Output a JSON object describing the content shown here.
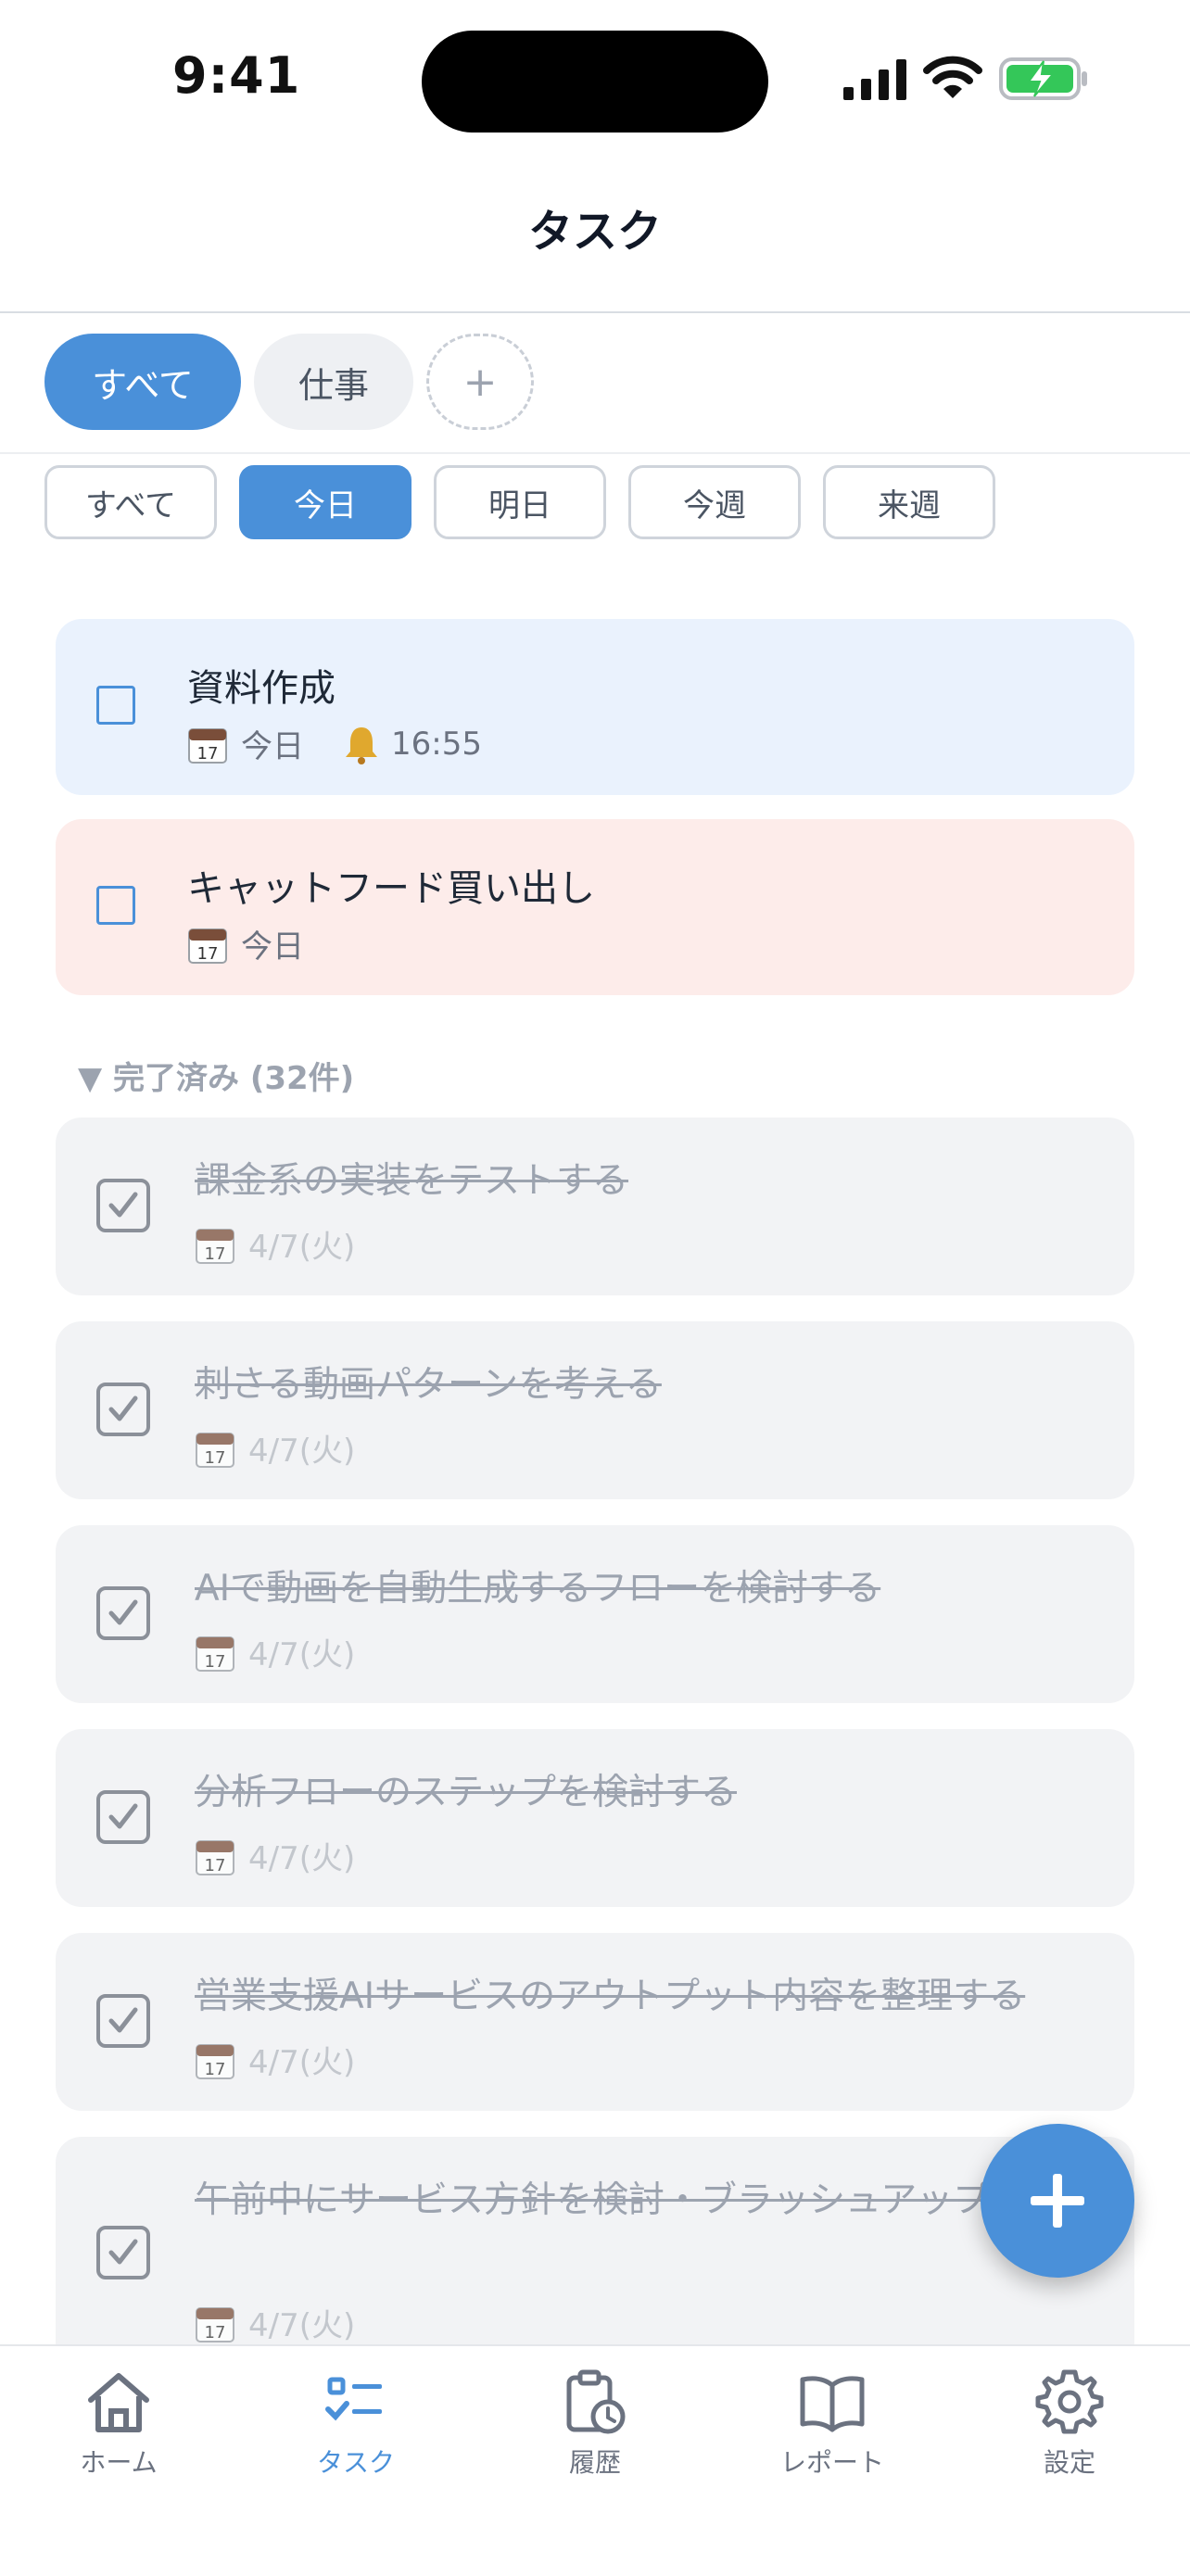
{
  "status_bar": {
    "time": "9:41"
  },
  "header": {
    "title": "タスク"
  },
  "categories": {
    "items": [
      {
        "label": "すべて",
        "active": true
      },
      {
        "label": "仕事",
        "active": false
      }
    ],
    "add_label": "+"
  },
  "date_filters": [
    {
      "label": "すべて",
      "active": false
    },
    {
      "label": "今日",
      "active": true
    },
    {
      "label": "明日",
      "active": false
    },
    {
      "label": "今週",
      "active": false
    },
    {
      "label": "来週",
      "active": false
    }
  ],
  "tasks": [
    {
      "title": "資料作成",
      "date": "今日",
      "reminder": "16:55",
      "color": "#eaf2fd"
    },
    {
      "title": "キャットフード買い出し",
      "date": "今日",
      "color": "#fdecea"
    }
  ],
  "completed": {
    "label": "▼ 完了済み (32件)",
    "items": [
      {
        "title": "課金系の実装をテストする",
        "date": "4/7(火)"
      },
      {
        "title": "刺さる動画パターンを考える",
        "date": "4/7(火)"
      },
      {
        "title": "AIで動画を自動生成するフローを検討する",
        "date": "4/7(火)"
      },
      {
        "title": "分析フローのステップを検討する",
        "date": "4/7(火)"
      },
      {
        "title": "営業支援AIサービスのアウトプット内容を整理する",
        "date": "4/7(火)"
      },
      {
        "title": "午前中にサービス方針を検討・ブラッシュアップする",
        "date": "4/7(火)"
      }
    ]
  },
  "fab": {
    "icon": "plus-icon"
  },
  "bottom_nav": [
    {
      "label": "ホーム",
      "icon": "home-icon",
      "active": false
    },
    {
      "label": "タスク",
      "icon": "checklist-icon",
      "active": true
    },
    {
      "label": "履歴",
      "icon": "history-icon",
      "active": false
    },
    {
      "label": "レポート",
      "icon": "book-icon",
      "active": false
    },
    {
      "label": "設定",
      "icon": "gear-icon",
      "active": false
    }
  ],
  "colors": {
    "accent": "#4a90d9",
    "completed_bg": "#f2f3f5",
    "muted": "#9ca3af"
  }
}
